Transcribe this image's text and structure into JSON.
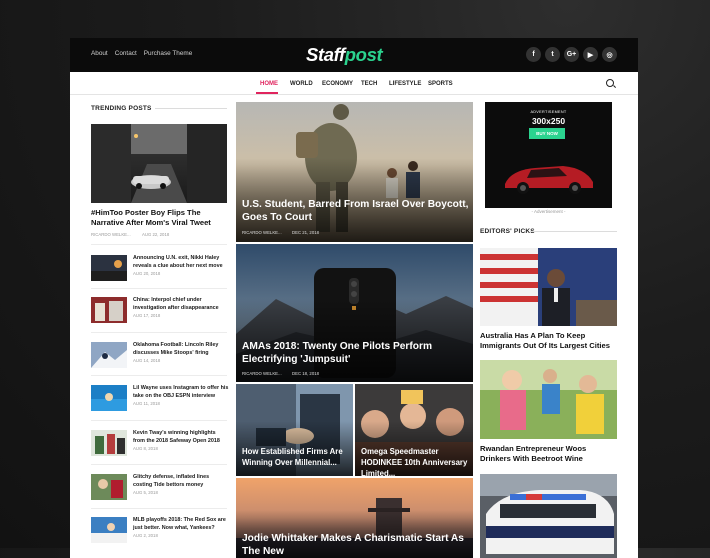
{
  "top_links": [
    "About",
    "Contact",
    "Purchase Theme"
  ],
  "logo": {
    "part1": "Staff",
    "part2": "post"
  },
  "social_icons": [
    {
      "name": "facebook-icon",
      "glyph": "f"
    },
    {
      "name": "twitter-icon",
      "glyph": "t"
    },
    {
      "name": "googleplus-icon",
      "glyph": "G+"
    },
    {
      "name": "youtube-icon",
      "glyph": "▶"
    },
    {
      "name": "instagram-icon",
      "glyph": "◎"
    }
  ],
  "nav": [
    "HOME",
    "WORLD",
    "ECONOMY",
    "TECH",
    "LIFESTYLE",
    "SPORTS"
  ],
  "trending": {
    "heading": "TRENDING POSTS",
    "lead": {
      "title": "#HimToo Poster Boy Flips The Narrative After Mom's Viral Tweet",
      "author": "RICARDO WELKE...",
      "date": "AUG 22, 2018"
    },
    "items": [
      {
        "title": "Announcing U.N. exit, Nikki Haley reveals a clue about her next move",
        "date": "AUG 20, 2018"
      },
      {
        "title": "China: Interpol chief under investigation after disappearance",
        "date": "AUG 17, 2018"
      },
      {
        "title": "Oklahoma Football: Lincoln Riley discusses Mike Stoops' firing",
        "date": "AUG 14, 2018"
      },
      {
        "title": "Lil Wayne uses Instagram to offer his take on the OBJ ESPN interview",
        "date": "AUG 11, 2018"
      },
      {
        "title": "Kevin Tway's winning highlights from the 2018 Safeway Open 2018",
        "date": "AUG 8, 2018"
      },
      {
        "title": "Glitchy defense, inflated lines costing Tide bettors money",
        "date": "AUG 5, 2018"
      },
      {
        "title": "MLB playoffs 2018: The Red Sox are just better. Now what, Yankees?",
        "date": "AUG 2, 2018"
      }
    ]
  },
  "center": {
    "feature1": {
      "title": "U.S. Student, Barred From Israel Over Boycott, Goes To Court",
      "author": "RICARDO WELKE...",
      "date": "DEC 21, 2018"
    },
    "feature2": {
      "title": "AMAs 2018: Twenty One Pilots Perform Electrifying 'Jumpsuit'",
      "author": "RICARDO WELKE...",
      "date": "DEC 18, 2018"
    },
    "small1": {
      "title": "How Established Firms Are Winning Over Millennial..."
    },
    "small2": {
      "title": "Omega Speedmaster HODINKEE 10th Anniversary Limited..."
    },
    "feature3": {
      "title": "Jodie Whittaker Makes A Charismatic Start As The New"
    }
  },
  "ad": {
    "label": "ADVERTISEMENT",
    "size": "300x250",
    "button": "BUY NOW",
    "caption": "- Advertisement -"
  },
  "editors": {
    "heading": "EDITORS' PICKS",
    "items": [
      {
        "title": "Australia Has A Plan To Keep Immigrants Out Of Its Largest Cities"
      },
      {
        "title": "Rwandan Entrepreneur Woos Drinkers With Beetroot Wine"
      }
    ]
  },
  "colors": {
    "accent": "#e0245e",
    "brand": "#2bd38f",
    "topbar": "#0b0b0b"
  }
}
